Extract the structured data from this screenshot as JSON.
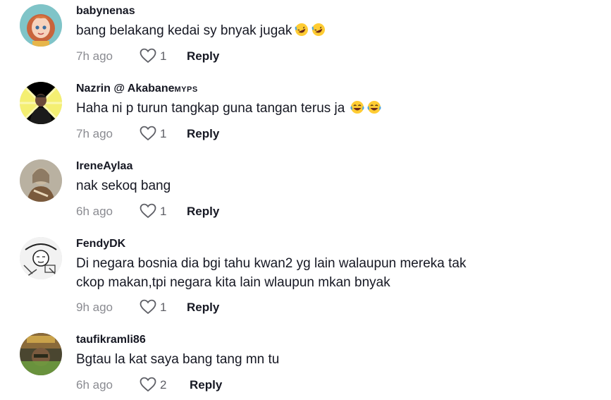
{
  "colors": {
    "username": "#161823",
    "text": "#161823",
    "meta": "#8a8b91"
  },
  "comments": [
    {
      "username": "babynenas",
      "badge": "",
      "lines": [
        "bang belakang kedai sy bnyak jugak"
      ],
      "emoji": [
        "rofl-emoji",
        "rofl-emoji"
      ],
      "time": "7h ago",
      "likes": "1",
      "reply": "Reply"
    },
    {
      "username": "Nazrin @ Akabane",
      "badge": "MYPS",
      "lines": [
        "Haha ni p turun tangkap guna tangan terus ja"
      ],
      "emoji": [
        "tears-of-joy-emoji",
        "tears-of-joy-emoji"
      ],
      "time": "7h ago",
      "likes": "1",
      "reply": "Reply"
    },
    {
      "username": "IreneAylaa",
      "badge": "",
      "lines": [
        "nak sekoq bang"
      ],
      "emoji": [],
      "time": "6h ago",
      "likes": "1",
      "reply": "Reply"
    },
    {
      "username": "FendyDK",
      "badge": "",
      "lines": [
        "Di negara bosnia dia bgi tahu kwan2 yg lain walaupun mereka tak",
        "ckop makan,tpi negara kita lain wlaupun mkan bnyak"
      ],
      "emoji": [],
      "time": "9h ago",
      "likes": "1",
      "reply": "Reply"
    },
    {
      "username": "taufikramli86",
      "badge": "",
      "lines": [
        "Bgtau la kat saya bang tang mn tu"
      ],
      "emoji": [],
      "time": "6h ago",
      "likes": "2",
      "reply": "Reply"
    }
  ]
}
